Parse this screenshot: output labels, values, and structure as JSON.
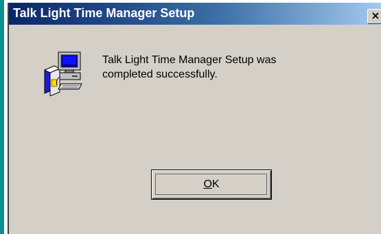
{
  "window": {
    "title": "Talk Light Time Manager Setup",
    "close_label": "×"
  },
  "message": {
    "line1": "Talk Light Time Manager Setup was",
    "line2": "completed successfully."
  },
  "ok_button": {
    "mnemonic": "O",
    "rest": "K"
  },
  "icons": {
    "setup": "computer-setup-icon",
    "close": "close-icon"
  },
  "colors": {
    "titlebar_start": "#0a246a",
    "titlebar_end": "#a6caf0",
    "dialog_face": "#d4d0c8",
    "desktop_strip": "#098f8f"
  }
}
